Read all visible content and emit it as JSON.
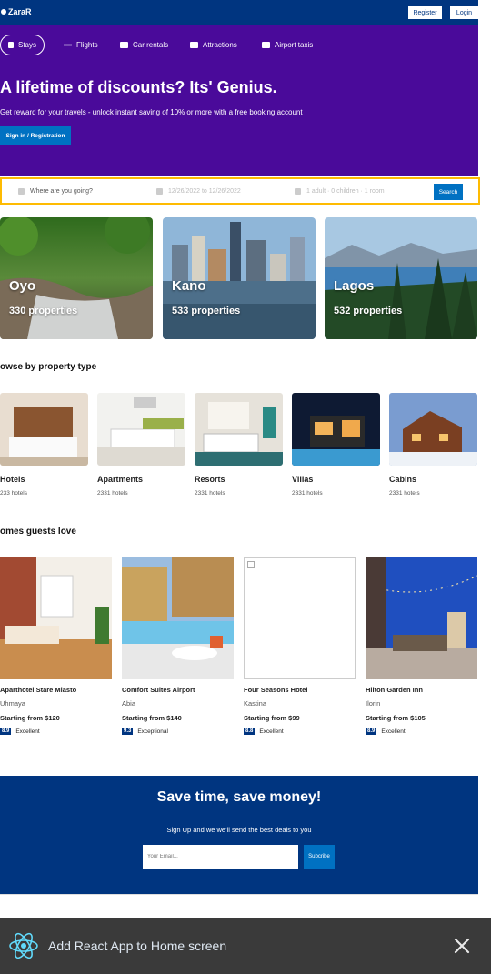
{
  "navbar": {
    "logo": "ZaraR",
    "register": "Register",
    "login": "Login"
  },
  "tabs": [
    {
      "label": "Stays",
      "icon": "bed-icon"
    },
    {
      "label": "Flights",
      "icon": "plane-icon"
    },
    {
      "label": "Car rentals",
      "icon": "car-icon"
    },
    {
      "label": "Attractions",
      "icon": "bed-icon"
    },
    {
      "label": "Airport taxis",
      "icon": "taxi-icon"
    }
  ],
  "hero": {
    "title": "A lifetime of discounts? Its' Genius.",
    "desc": "Get reward for your travels - unlock instant saving of 10% or more with a free booking account",
    "signin": "Sign in / Registration"
  },
  "search": {
    "destination_placeholder": "Where are you going?",
    "dates": "12/26/2022 to 12/26/2022",
    "guests": "1 adult · 0 children · 1 room",
    "button": "Search"
  },
  "featured": [
    {
      "name": "Oyo",
      "props": "330 properties"
    },
    {
      "name": "Kano",
      "props": "533 properties"
    },
    {
      "name": "Lagos",
      "props": "532 properties"
    }
  ],
  "property_section_title": "owse by property type",
  "property_types": [
    {
      "title": "Hotels",
      "count": "233 hotels"
    },
    {
      "title": "Apartments",
      "count": "2331 hotels"
    },
    {
      "title": "Resorts",
      "count": "2331 hotels"
    },
    {
      "title": "Villas",
      "count": "2331 hotels"
    },
    {
      "title": "Cabins",
      "count": "2331 hotels"
    }
  ],
  "guests_section_title": "omes guests love",
  "guest_homes": [
    {
      "name": "Aparthotel Stare Miasto",
      "city": "Uhmaya",
      "price": "Starting from $120",
      "rating": "8.9",
      "rating_text": "Excellent"
    },
    {
      "name": "Comfort Suites Airport",
      "city": "Abia",
      "price": "Starting from $140",
      "rating": "9.3",
      "rating_text": "Exceptional"
    },
    {
      "name": "Four Seasons Hotel",
      "city": "Kastina",
      "price": "Starting from $99",
      "rating": "8.8",
      "rating_text": "Excellent"
    },
    {
      "name": "Hilton Garden Inn",
      "city": "Ilorin",
      "price": "Starting from $105",
      "rating": "8.9",
      "rating_text": "Excellent"
    }
  ],
  "newsletter": {
    "title": "Save time, save money!",
    "desc": "Sign Up and we we'll send the best deals to you",
    "email_placeholder": "Your Email...",
    "subscribe": "Subcribe"
  },
  "install_bar": {
    "label": "Add React App to Home screen"
  },
  "colors": {
    "nav": "#003580",
    "hero": "#4a0a9a",
    "accent": "#0071c2",
    "search_border": "#febb02"
  }
}
